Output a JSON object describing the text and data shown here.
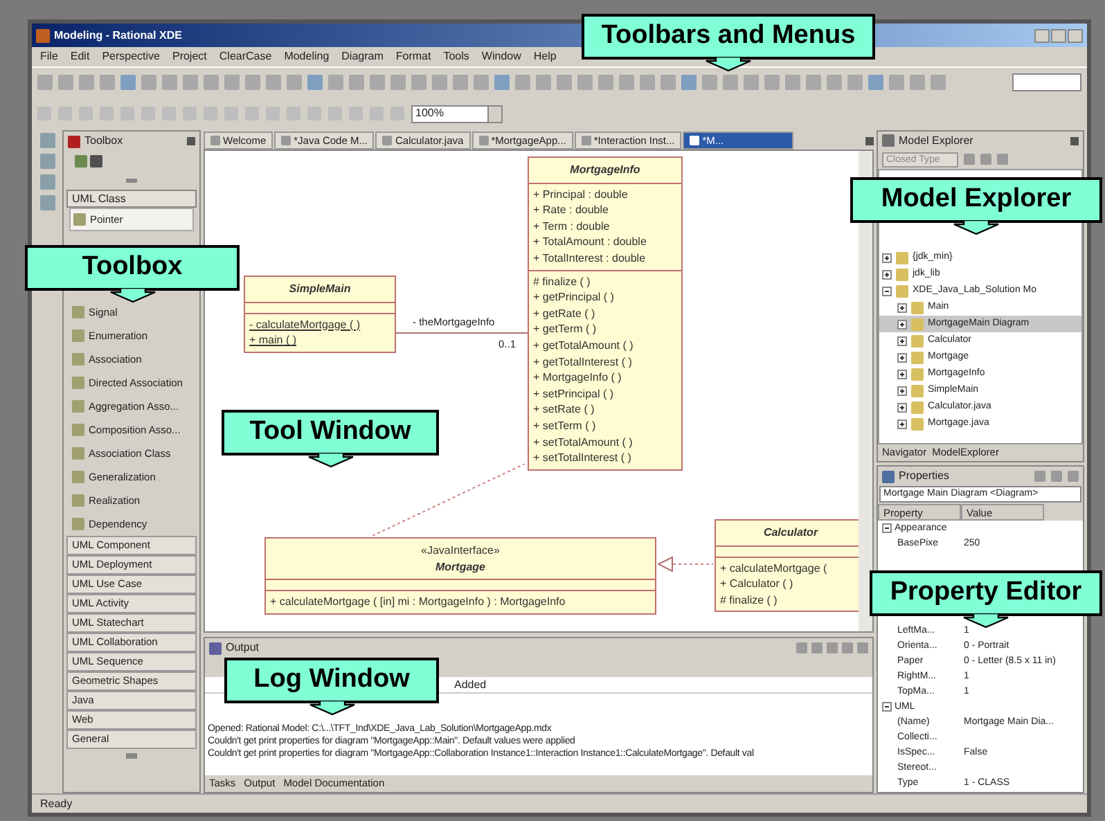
{
  "window": {
    "title": "Modeling - Rational XDE"
  },
  "menu": [
    "File",
    "Edit",
    "Perspective",
    "Project",
    "ClearCase",
    "Modeling",
    "Diagram",
    "Format",
    "Tools",
    "Window",
    "Help"
  ],
  "toolbar": {
    "zoom": "100%"
  },
  "toolbox": {
    "title": "Toolbox",
    "group": "UML Class",
    "items": [
      {
        "label": "Pointer",
        "selected": true
      },
      {
        "label": "Signal",
        "selected": false
      },
      {
        "label": "Enumeration",
        "selected": false
      },
      {
        "label": "Association",
        "selected": false
      },
      {
        "label": "Directed Association",
        "selected": false
      },
      {
        "label": "Aggregation Asso...",
        "selected": false
      },
      {
        "label": "Composition Asso...",
        "selected": false
      },
      {
        "label": "Association Class",
        "selected": false
      },
      {
        "label": "Generalization",
        "selected": false
      },
      {
        "label": "Realization",
        "selected": false
      },
      {
        "label": "Dependency",
        "selected": false
      }
    ],
    "categories": [
      "UML Component",
      "UML Deployment",
      "UML Use Case",
      "UML Activity",
      "UML Statechart",
      "UML Collaboration",
      "UML Sequence",
      "Geometric Shapes",
      "Java",
      "Web",
      "General"
    ]
  },
  "editor_tabs": [
    {
      "label": "Welcome",
      "selected": false
    },
    {
      "label": "*Java Code M...",
      "selected": false
    },
    {
      "label": "Calculator.java",
      "selected": false
    },
    {
      "label": "*MortgageApp...",
      "selected": false
    },
    {
      "label": "*Interaction Inst...",
      "selected": false
    },
    {
      "label": "*M...",
      "selected": true
    }
  ],
  "diagram": {
    "classes": [
      {
        "name": "SimpleMain",
        "operations": [
          "- calculateMortgage ( )",
          "+ main ( )"
        ]
      },
      {
        "name": "MortgageInfo",
        "attributes": [
          "+ Principal : double",
          "+ Rate : double",
          "+ Term : double",
          "+ TotalAmount : double",
          "+ TotalInterest : double"
        ],
        "operations": [
          "# finalize ( )",
          "+ getPrincipal ( )",
          "+ getRate ( )",
          "+ getTerm ( )",
          "+ getTotalAmount ( )",
          "+ getTotalInterest ( )",
          "+ MortgageInfo ( )",
          "+ setPrincipal ( )",
          "+ setRate ( )",
          "+ setTerm ( )",
          "+ setTotalAmount ( )",
          "+ setTotalInterest ( )"
        ]
      },
      {
        "name": "Mortgage",
        "stereotype": "«JavaInterface»",
        "operations": [
          "+ calculateMortgage ( [in] mi : MortgageInfo ) : MortgageInfo"
        ]
      },
      {
        "name": "Calculator",
        "operations": [
          "+ calculateMortgage (",
          "+ Calculator ( )",
          "# finalize ( )"
        ]
      }
    ],
    "association": {
      "role": "- theMortgageInfo",
      "multiplicity": "0..1"
    }
  },
  "output": {
    "title": "Output",
    "column": "Added",
    "lines": [
      "Opened: Rational Model: C:\\...\\TFT_Ind\\XDE_Java_Lab_Solution\\MortgageApp.mdx",
      "Couldn't get print properties for diagram \"MortgageApp::Main\". Default values were applied",
      "Couldn't get print properties for diagram \"MortgageApp::Collaboration Instance1::Interaction Instance1::CalculateMortgage\". Default val"
    ],
    "tabs": [
      "Tasks",
      "Output",
      "Model Documentation"
    ]
  },
  "model_explorer": {
    "title": "Model Explorer",
    "filter": "Closed Type",
    "tree": [
      {
        "label": "{jdk_min}",
        "expanded": false,
        "selected": false
      },
      {
        "label": "jdk_lib",
        "expanded": false,
        "selected": false
      },
      {
        "label": "XDE_Java_Lab_Solution Mo",
        "expanded": true,
        "selected": false,
        "children": [
          {
            "label": "Main",
            "expanded": false,
            "selected": false
          },
          {
            "label": "MortgageMain Diagram",
            "expanded": false,
            "selected": true
          },
          {
            "label": "Calculator",
            "expanded": false,
            "selected": false
          },
          {
            "label": "Mortgage",
            "expanded": false,
            "selected": false
          },
          {
            "label": "MortgageInfo",
            "expanded": false,
            "selected": false
          },
          {
            "label": "SimpleMain",
            "expanded": false,
            "selected": false
          },
          {
            "label": "Calculator.java",
            "expanded": false,
            "selected": false
          },
          {
            "label": "Mortgage.java",
            "expanded": false,
            "selected": false
          }
        ]
      }
    ],
    "tabs": [
      "Navigator",
      "ModelExplorer"
    ]
  },
  "properties": {
    "title": "Properties",
    "object": "Mortgage Main Diagram <Diagram>",
    "columns": [
      "Property",
      "Value"
    ],
    "rows": [
      {
        "kind": "group",
        "name": "Appearance"
      },
      {
        "kind": "row",
        "name": "BasePixe",
        "value": "250"
      },
      {
        "kind": "gap"
      },
      {
        "kind": "row",
        "name": "LeftMa...",
        "value": "1"
      },
      {
        "kind": "row",
        "name": "Orienta...",
        "value": "0 - Portrait"
      },
      {
        "kind": "row",
        "name": "Paper",
        "value": "0 - Letter (8.5 x 11 in)"
      },
      {
        "kind": "row",
        "name": "RightM...",
        "value": "1"
      },
      {
        "kind": "row",
        "name": "TopMa...",
        "value": "1"
      },
      {
        "kind": "group",
        "name": "UML"
      },
      {
        "kind": "row",
        "name": "(Name)",
        "value": "Mortgage Main Dia..."
      },
      {
        "kind": "row",
        "name": "Collecti...",
        "value": ""
      },
      {
        "kind": "row",
        "name": "IsSpec...",
        "value": "False"
      },
      {
        "kind": "row",
        "name": "Stereot...",
        "value": ""
      },
      {
        "kind": "row",
        "name": "Type",
        "value": "1 - CLASS"
      }
    ]
  },
  "status_bar": "Ready",
  "callouts": [
    "Toolbars and Menus",
    "Model Explorer",
    "Toolbox",
    "Tool Window",
    "Log Window",
    "Property Editor"
  ]
}
